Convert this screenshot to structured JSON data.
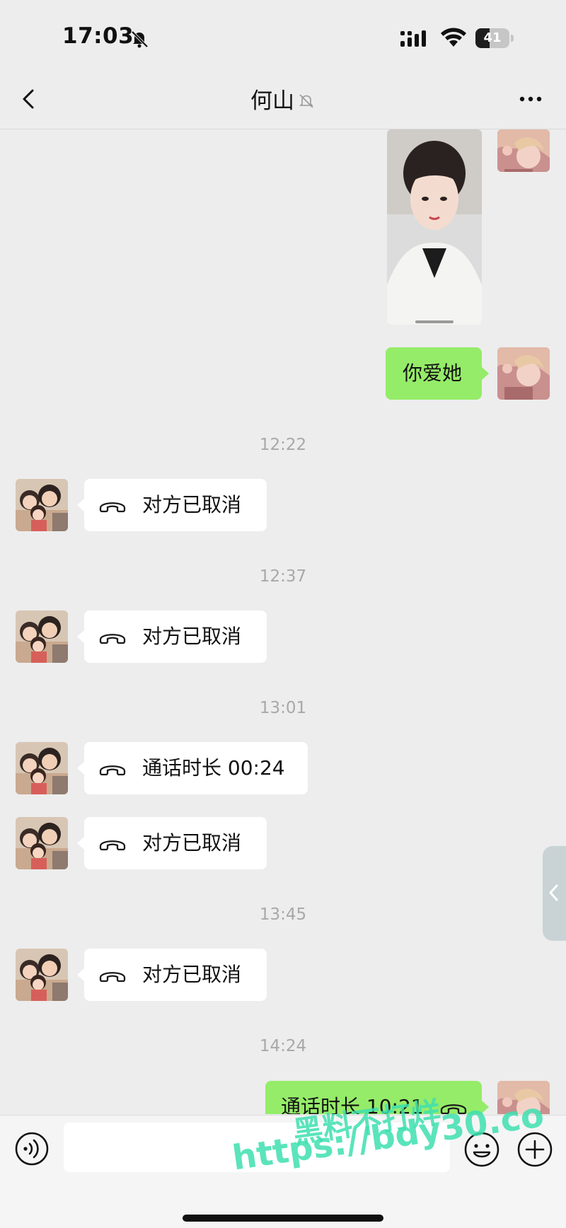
{
  "status_bar": {
    "time": "17:03",
    "battery_level": "41",
    "battery_fraction": 0.41
  },
  "nav": {
    "title": "何山"
  },
  "messages": {
    "m_love": "你爱她",
    "ts1": "12:22",
    "m_cancel1": "对方已取消",
    "ts2": "12:37",
    "m_cancel2": "对方已取消",
    "ts3": "13:01",
    "m_dur1": "通话时长 00:24",
    "m_cancel3": "对方已取消",
    "ts4": "13:45",
    "m_cancel4": "对方已取消",
    "ts5": "14:24",
    "m_dur2": "通话时长 10:21"
  },
  "watermark": {
    "line1": "黑料不打烊",
    "line2": "https://bdy30.co"
  },
  "colors": {
    "background": "#ededed",
    "outgoing_bubble": "#95ec69",
    "incoming_bubble": "#ffffff",
    "timestamp": "#a8a8a8",
    "watermark": "#3fe0b0"
  },
  "icons": {
    "back": "chevron-left-icon",
    "mute": "bell-off-icon",
    "more": "more-dots-icon",
    "call": "phone-hangup-icon",
    "voice": "voice-icon",
    "emoji": "emoji-icon",
    "plus": "plus-circle-icon"
  }
}
